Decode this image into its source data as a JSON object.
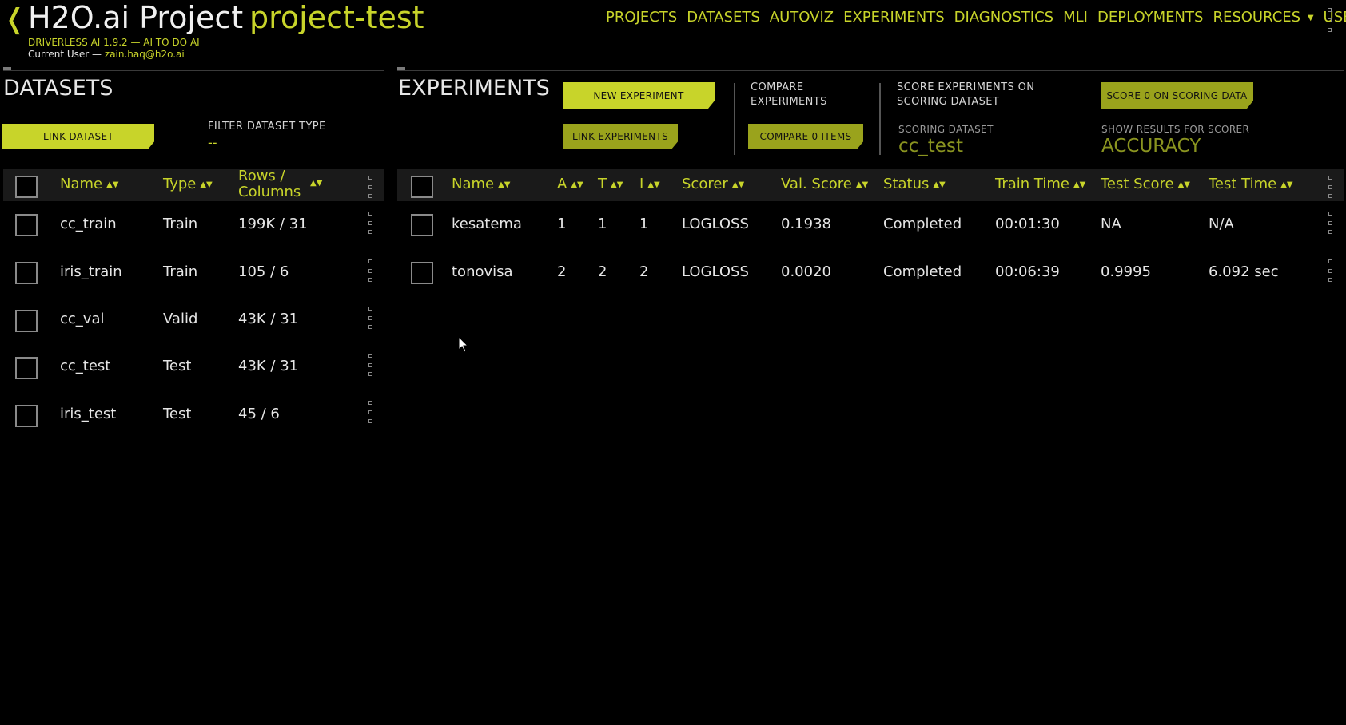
{
  "header": {
    "back_glyph": "❬",
    "app_title": "H2O.ai Project",
    "project_name": "project-test",
    "version_line": "DRIVERLESS AI 1.9.2 — AI TO DO AI",
    "user_prefix": "Current User —",
    "user_email": "zain.haq@h2o.ai"
  },
  "nav": {
    "items": [
      "PROJECTS",
      "DATASETS",
      "AUTOVIZ",
      "EXPERIMENTS",
      "DIAGNOSTICS",
      "MLI",
      "DEPLOYMENTS"
    ],
    "resources": "RESOURCES",
    "user": "USER",
    "caret": "▼"
  },
  "datasets": {
    "title": "DATASETS",
    "link_button": "LINK DATASET",
    "filter_label": "FILTER DATASET TYPE",
    "filter_value": "--",
    "columns": {
      "name": "Name",
      "type": "Type",
      "rows_cols_1": "Rows /",
      "rows_cols_2": "Columns"
    },
    "rows": [
      {
        "name": "cc_train",
        "type": "Train",
        "size": "199K / 31"
      },
      {
        "name": "iris_train",
        "type": "Train",
        "size": "105 / 6"
      },
      {
        "name": "cc_val",
        "type": "Valid",
        "size": "43K / 31"
      },
      {
        "name": "cc_test",
        "type": "Test",
        "size": "43K / 31"
      },
      {
        "name": "iris_test",
        "type": "Test",
        "size": "45 / 6"
      }
    ]
  },
  "experiments": {
    "title": "EXPERIMENTS",
    "new_button": "NEW EXPERIMENT",
    "link_button": "LINK EXPERIMENTS",
    "compare_label_1": "COMPARE",
    "compare_label_2": "EXPERIMENTS",
    "compare_button": "COMPARE 0 ITEMS",
    "score_label_1": "SCORE EXPERIMENTS ON",
    "score_label_2": "SCORING DATASET",
    "score_button": "SCORE 0 ON SCORING DATA",
    "scoring_dataset_label": "SCORING DATASET",
    "scoring_dataset_value": "cc_test",
    "scorer_label": "SHOW RESULTS FOR SCORER",
    "scorer_value": "ACCURACY",
    "columns": {
      "name": "Name",
      "a": "A",
      "t": "T",
      "i": "I",
      "scorer": "Scorer",
      "val_score": "Val. Score",
      "status": "Status",
      "train_time": "Train Time",
      "test_score": "Test Score",
      "test_time": "Test Time"
    },
    "rows": [
      {
        "name": "kesatema",
        "a": "1",
        "t": "1",
        "i": "1",
        "scorer": "LOGLOSS",
        "val_score": "0.1938",
        "status": "Completed",
        "train_time": "00:01:30",
        "test_score": "NA",
        "test_time": "N/A"
      },
      {
        "name": "tonovisa",
        "a": "2",
        "t": "2",
        "i": "2",
        "scorer": "LOGLOSS",
        "val_score": "0.0020",
        "status": "Completed",
        "train_time": "00:06:39",
        "test_score": "0.9995",
        "test_time": "6.092 sec"
      }
    ]
  },
  "ui": {
    "sort_glyph": "▲▼",
    "cursor_glyph": "➤"
  },
  "colors": {
    "accent": "#c8d42a",
    "background": "#000000",
    "header_bar": "#1a1a1a"
  }
}
